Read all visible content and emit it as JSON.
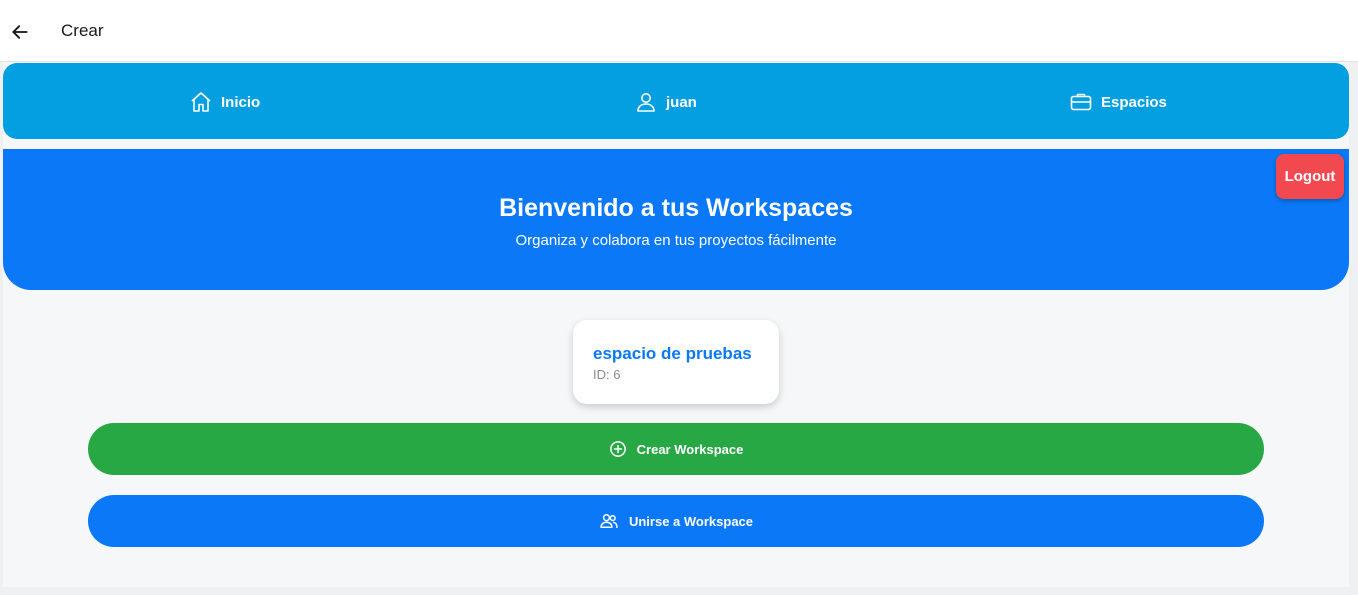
{
  "topbar": {
    "title": "Crear",
    "back_icon": "arrow-left-icon"
  },
  "nav": {
    "items": [
      {
        "label": "Inicio",
        "icon": "home-icon"
      },
      {
        "label": "juan",
        "icon": "user-icon"
      },
      {
        "label": "Espacios",
        "icon": "briefcase-icon"
      }
    ]
  },
  "hero": {
    "title": "Bienvenido a tus Workspaces",
    "subtitle": "Organiza y colabora en tus proyectos fácilmente"
  },
  "logout_label": "Logout",
  "workspaces": [
    {
      "name": "espacio de pruebas",
      "id_text": "ID: 6"
    }
  ],
  "actions": {
    "create_label": "Crear Workspace",
    "create_icon": "plus-circle-icon",
    "join_label": "Unirse a Workspace",
    "join_icon": "users-icon"
  },
  "colors": {
    "nav_bg": "#049fe0",
    "hero_bg": "#0a78f7",
    "logout_bg": "#f2484f",
    "create_bg": "#28a745",
    "join_bg": "#0a78f7",
    "card_title": "#0a78f7"
  }
}
